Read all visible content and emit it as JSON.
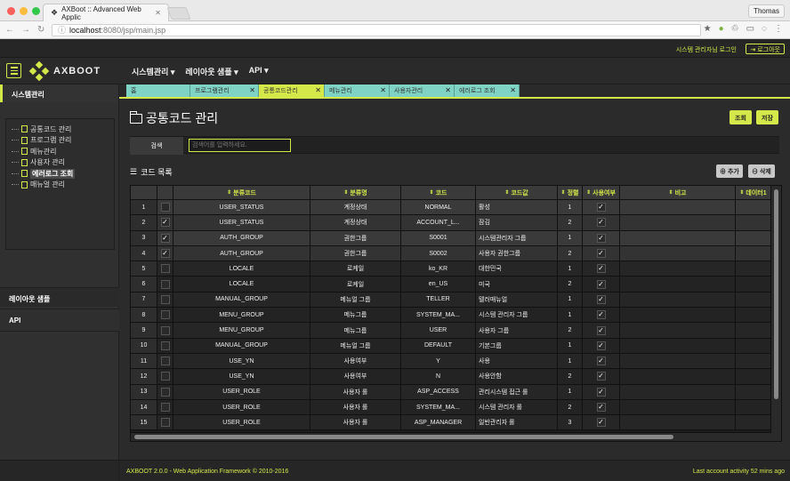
{
  "browser": {
    "tab_title": "AXBoot :: Advanced Web Applic",
    "address_host": "localhost",
    "address_path": ":8080/jsp/main.jsp",
    "profile": "Thomas"
  },
  "topbar": {
    "login_message": "시스템 관리자님 로그인",
    "logout_label": "로그아웃"
  },
  "header": {
    "logo_text": "AXBOOT",
    "menus": [
      "시스템관리 ▾",
      "레이아웃 샘플 ▾",
      "API ▾"
    ]
  },
  "sidebar": {
    "section1": "시스템관리",
    "tree": [
      "공통코드 관리",
      "프로그램 관리",
      "메뉴관리",
      "사용자 관리",
      "에러로그 조회",
      "매뉴얼 관리"
    ],
    "selected_index": 4,
    "section2": "레이아웃 샘플",
    "section3": "API"
  },
  "pagetabs": [
    {
      "label": "홈",
      "closable": false
    },
    {
      "label": "프로그램관리",
      "closable": true
    },
    {
      "label": "공통코드관리",
      "closable": true,
      "active": true
    },
    {
      "label": "메뉴관리",
      "closable": true
    },
    {
      "label": "사용자관리",
      "closable": true
    },
    {
      "label": "에러로그 조회",
      "closable": true
    }
  ],
  "page": {
    "title": "공통코드 관리",
    "btn_search": "조회",
    "btn_save": "저장",
    "search_label": "검색",
    "search_placeholder": "검색어를 입력하세요.",
    "list_title": "코드 목록",
    "btn_add": "추가",
    "btn_delete": "삭제"
  },
  "grid": {
    "columns": [
      "",
      "",
      "분류코드",
      "분류명",
      "코드",
      "코드값",
      "정렬",
      "사용여부",
      "비고",
      "데이터1"
    ],
    "rows": [
      [
        "1",
        false,
        "USER_STATUS",
        "계정상태",
        "NORMAL",
        "활성",
        "1",
        true
      ],
      [
        "2",
        true,
        "USER_STATUS",
        "계정상태",
        "ACCOUNT_L...",
        "잠김",
        "2",
        true
      ],
      [
        "3",
        true,
        "AUTH_GROUP",
        "권한그룹",
        "S0001",
        "시스템관리자 그룹",
        "1",
        true
      ],
      [
        "4",
        true,
        "AUTH_GROUP",
        "권한그룹",
        "S0002",
        "사용자 권한그룹",
        "2",
        true
      ],
      [
        "5",
        false,
        "LOCALE",
        "로케일",
        "ko_KR",
        "대한민국",
        "1",
        true
      ],
      [
        "6",
        false,
        "LOCALE",
        "로케일",
        "en_US",
        "미국",
        "2",
        true
      ],
      [
        "7",
        false,
        "MANUAL_GROUP",
        "메뉴얼 그룹",
        "TELLER",
        "텔러매뉴얼",
        "1",
        true
      ],
      [
        "8",
        false,
        "MENU_GROUP",
        "메뉴그룹",
        "SYSTEM_MA...",
        "시스템 관리자 그룹",
        "1",
        true
      ],
      [
        "9",
        false,
        "MENU_GROUP",
        "메뉴그룹",
        "USER",
        "사용자 그룹",
        "2",
        true
      ],
      [
        "10",
        false,
        "MANUAL_GROUP",
        "메뉴얼 그룹",
        "DEFAULT",
        "기본그룹",
        "1",
        true
      ],
      [
        "11",
        false,
        "USE_YN",
        "사용여부",
        "Y",
        "사용",
        "1",
        true
      ],
      [
        "12",
        false,
        "USE_YN",
        "사용여부",
        "N",
        "사용안함",
        "2",
        true
      ],
      [
        "13",
        false,
        "USER_ROLE",
        "사용자 롤",
        "ASP_ACCESS",
        "관리시스템 접근 롤",
        "1",
        true
      ],
      [
        "14",
        false,
        "USER_ROLE",
        "사용자 롤",
        "SYSTEM_MA...",
        "시스템 관리자 롤",
        "2",
        true
      ],
      [
        "15",
        false,
        "USER_ROLE",
        "사용자 롤",
        "ASP_MANAGER",
        "일반관리자 롤",
        "3",
        true
      ]
    ]
  },
  "footer": {
    "left": "AXBOOT 2.0.0 - Web Application Framework © 2010-2016",
    "right": "Last account activity 52 mins ago"
  }
}
